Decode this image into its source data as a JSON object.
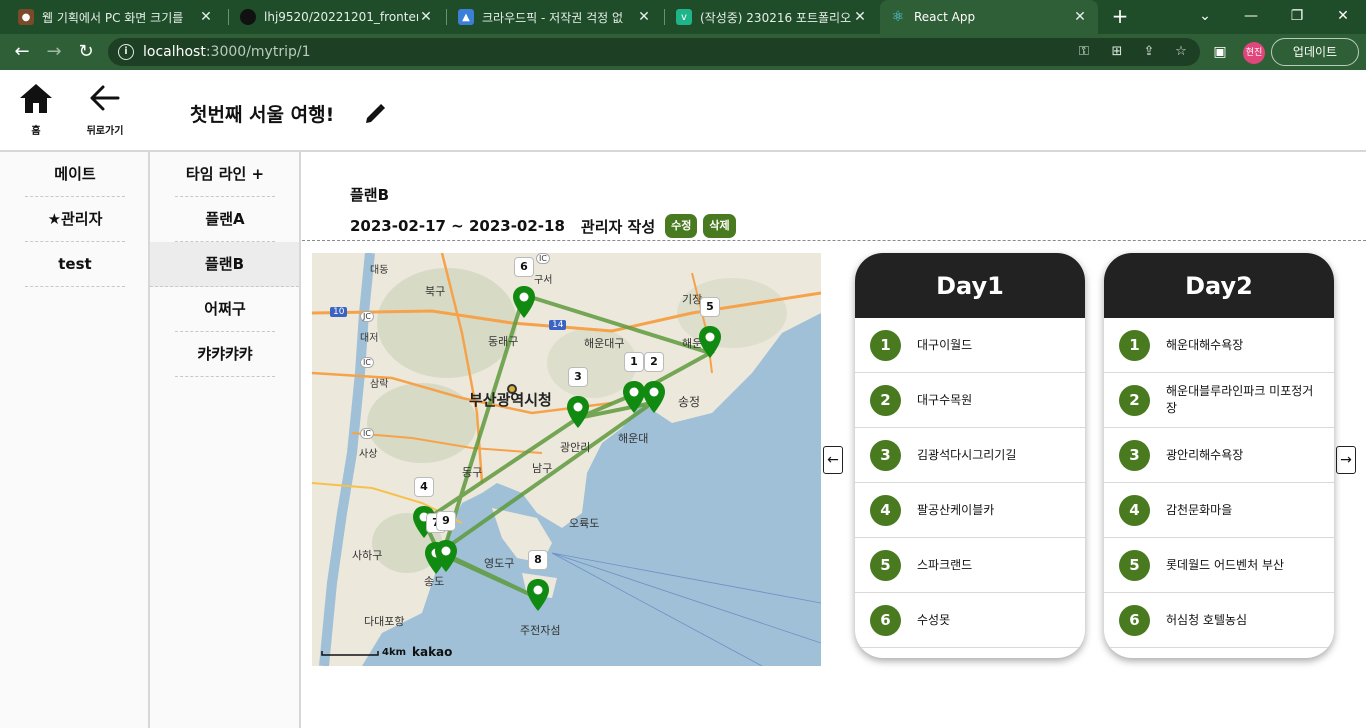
{
  "browser": {
    "tabs": [
      {
        "title": "웹 기획에서 PC 화면 크기를"
      },
      {
        "title": "lhj9520/20221201_frontendp"
      },
      {
        "title": "크라우드픽 - 저작권 걱정 없"
      },
      {
        "title": "(작성중) 230216 포트폴리오"
      },
      {
        "title": "React App"
      }
    ],
    "url_host": "localhost",
    "url_path": ":3000/mytrip/1",
    "profile_label": "현진",
    "update_label": "업데이트"
  },
  "header": {
    "home_label": "홈",
    "back_label": "뒤로가기",
    "trip_title": "첫번째 서울 여행!"
  },
  "mates": {
    "items": [
      {
        "label": "메이트"
      },
      {
        "label": "★관리자"
      },
      {
        "label": "test"
      }
    ]
  },
  "plans": {
    "timeline_label": "타임 라인 +",
    "items": [
      {
        "label": "플랜A"
      },
      {
        "label": "플랜B"
      },
      {
        "label": "어쩌구"
      },
      {
        "label": "캬캬캬캬"
      }
    ]
  },
  "plan": {
    "name": "플랜B",
    "dates": "2023-02-17 ~ 2023-02-18",
    "author": "관리자 작성",
    "edit_label": "수정",
    "delete_label": "삭제"
  },
  "map": {
    "city_label": "부산광역시청",
    "scale_label": "4km",
    "brand_label": "kakao",
    "place_labels": [
      "대동",
      "북구",
      "구서",
      "기장",
      "대저",
      "동래구",
      "해운대구",
      "해운대",
      "삼락",
      "송정",
      "사상",
      "광안리",
      "해운대",
      "동구",
      "남구",
      "오륙도",
      "사하구",
      "영도구",
      "송도",
      "다대포항",
      "주전자섬",
      "10",
      "14",
      "IC",
      "JC",
      "IC",
      "IC"
    ],
    "markers": [
      "1",
      "2",
      "3",
      "4",
      "5",
      "6",
      "7",
      "8",
      "9"
    ]
  },
  "days": [
    {
      "title": "Day1",
      "items": [
        {
          "num": "1",
          "place": "대구이월드"
        },
        {
          "num": "2",
          "place": "대구수목원"
        },
        {
          "num": "3",
          "place": "김광석다시그리기길"
        },
        {
          "num": "4",
          "place": "팔공산케이블카"
        },
        {
          "num": "5",
          "place": "스파크랜드"
        },
        {
          "num": "6",
          "place": "수성못"
        }
      ]
    },
    {
      "title": "Day2",
      "items": [
        {
          "num": "1",
          "place": "해운대해수욕장"
        },
        {
          "num": "2",
          "place": "해운대블루라인파크 미포정거장"
        },
        {
          "num": "3",
          "place": "광안리해수욕장"
        },
        {
          "num": "4",
          "place": "감천문화마을"
        },
        {
          "num": "5",
          "place": "롯데월드 어드벤처 부산"
        },
        {
          "num": "6",
          "place": "허심청 호텔농심"
        }
      ]
    }
  ],
  "colors": {
    "accent_green": "#4a7a1f",
    "marker_green": "#118a11",
    "route_green": "#5e9a3d",
    "chrome_green": "#2f5f37",
    "card_header": "#222222"
  }
}
